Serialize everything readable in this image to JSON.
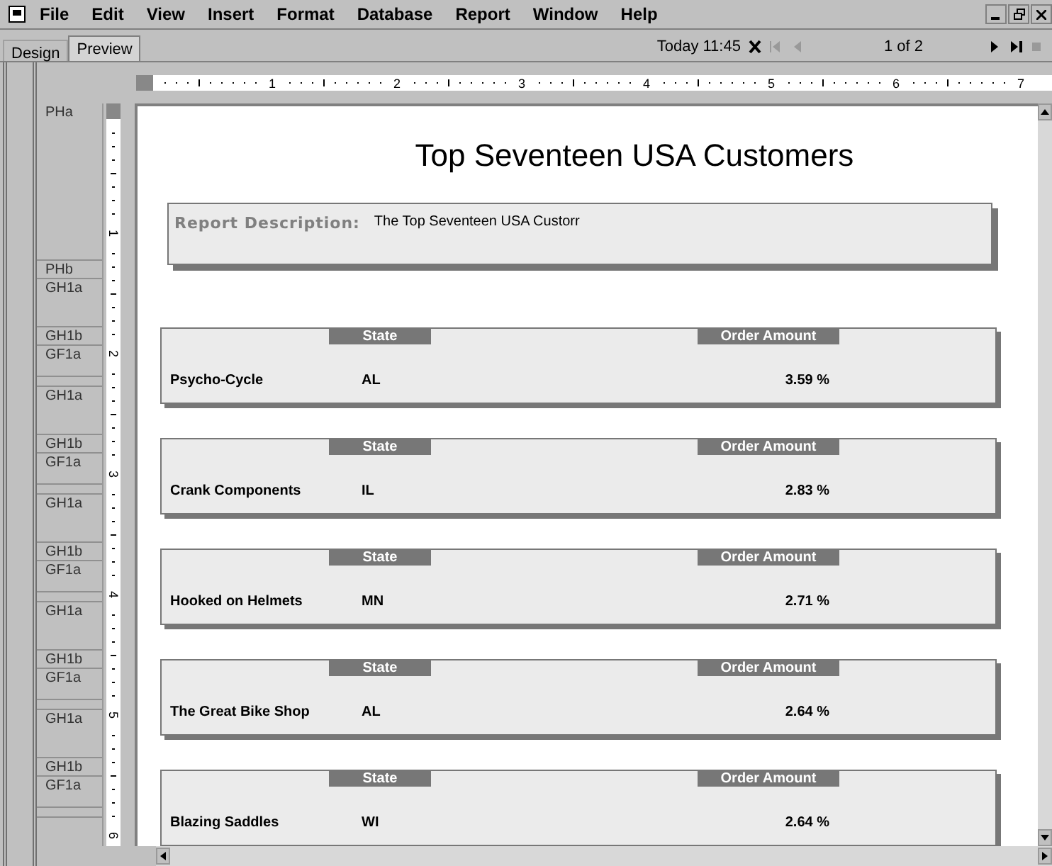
{
  "menu": [
    "File",
    "Edit",
    "View",
    "Insert",
    "Format",
    "Database",
    "Report",
    "Window",
    "Help"
  ],
  "tabs": [
    {
      "label": "Design",
      "selected": false
    },
    {
      "label": "Preview",
      "selected": true
    }
  ],
  "toolbar": {
    "data_date": "Today 11:45",
    "page": "1 of 2"
  },
  "ruler": {
    "marks": [
      "1",
      "2",
      "3",
      "4",
      "5",
      "6",
      "7"
    ]
  },
  "vertical_ruler": {
    "marks": [
      "1",
      "2",
      "3",
      "4",
      "5",
      "6"
    ]
  },
  "sections": [
    {
      "kind": "page",
      "label": "PHa"
    },
    {
      "kind": "line",
      "label": "PHb"
    },
    {
      "kind": "group",
      "label": "GH1a"
    },
    {
      "kind": "line",
      "label": "GH1b"
    },
    {
      "kind": "footer",
      "label": "GF1a"
    },
    {
      "kind": "divider"
    },
    {
      "kind": "group",
      "label": "GH1a"
    },
    {
      "kind": "line",
      "label": "GH1b"
    },
    {
      "kind": "footer",
      "label": "GF1a"
    },
    {
      "kind": "divider"
    },
    {
      "kind": "group",
      "label": "GH1a"
    },
    {
      "kind": "line",
      "label": "GH1b"
    },
    {
      "kind": "footer",
      "label": "GF1a"
    },
    {
      "kind": "divider"
    },
    {
      "kind": "group",
      "label": "GH1a"
    },
    {
      "kind": "line",
      "label": "GH1b"
    },
    {
      "kind": "footer",
      "label": "GF1a"
    },
    {
      "kind": "divider"
    },
    {
      "kind": "group",
      "label": "GH1a"
    },
    {
      "kind": "line",
      "label": "GH1b"
    },
    {
      "kind": "footer",
      "label": "GF1a"
    },
    {
      "kind": "divider"
    }
  ],
  "report": {
    "title": "Top Seventeen USA Customers",
    "description_label": "Report Description:",
    "description": "The Top Seventeen USA Custorr",
    "rows": [
      {
        "columns": [
          "State",
          "Order Amount"
        ],
        "name": "Psycho-Cycle",
        "state": "AL",
        "amount": "3.59 %"
      },
      {
        "columns": [
          "State",
          "Order Amount"
        ],
        "name": "Crank Components",
        "state": "IL",
        "amount": "2.83 %"
      },
      {
        "columns": [
          "State",
          "Order Amount"
        ],
        "name": "Hooked on Helmets",
        "state": "MN",
        "amount": "2.71 %"
      },
      {
        "columns": [
          "State",
          "Order Amount"
        ],
        "name": "The Great Bike Shop",
        "state": "AL",
        "amount": "2.64 %"
      },
      {
        "columns": [
          "State",
          "Order Amount"
        ],
        "name": "Blazing Saddles",
        "state": "WI",
        "amount": "2.64 %"
      }
    ]
  }
}
